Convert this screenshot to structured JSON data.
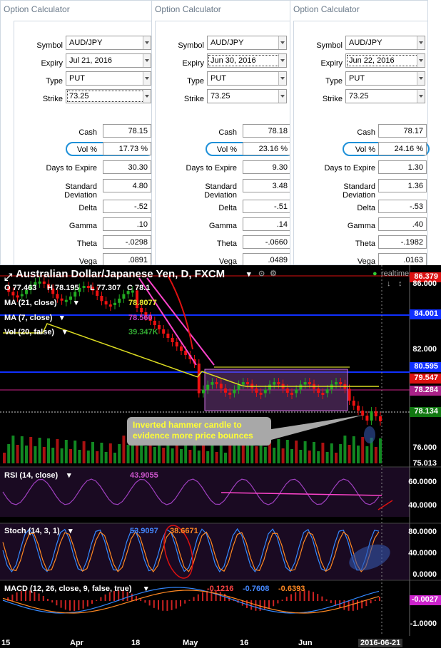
{
  "calculators": [
    {
      "title": "Option Calculator",
      "symbol": "AUD/JPY",
      "expiry": "Jul 21, 2016",
      "type": "PUT",
      "strike": "73.25",
      "cash": "78.15",
      "vol": "17.73 %",
      "days": "30.30",
      "stddev": "4.80",
      "delta": "-.52",
      "gamma": ".10",
      "theta": "-.0298",
      "vega": ".0891"
    },
    {
      "title": "Option Calculator",
      "symbol": "AUD/JPY",
      "expiry": "Jun 30, 2016",
      "type": "PUT",
      "strike": "73.25",
      "cash": "78.18",
      "vol": "23.16 %",
      "days": "9.30",
      "stddev": "3.48",
      "delta": "-.51",
      "gamma": ".14",
      "theta": "-.0660",
      "vega": ".0489"
    },
    {
      "title": "Option Calculator",
      "symbol": "AUD/JPY",
      "expiry": "Jun 22, 2016",
      "type": "PUT",
      "strike": "73.25",
      "cash": "78.17",
      "vol": "24.16 %",
      "days": "1.30",
      "stddev": "1.36",
      "delta": "-.53",
      "gamma": ".40",
      "theta": "-.1982",
      "vega": ".0163"
    }
  ],
  "labels": {
    "symbol": "Symbol",
    "expiry": "Expiry",
    "type": "Type",
    "strike": "Strike",
    "cash": "Cash",
    "vol": "Vol %",
    "days": "Days to Expire",
    "stddev": "Standard Deviation",
    "delta": "Delta",
    "gamma": "Gamma",
    "theta": "Theta",
    "vega": "Vega"
  },
  "chart": {
    "title": "Australian Dollar/Japanese Yen, D, FXCM",
    "realtime": "realtime",
    "ohlc": {
      "o": "O 77.463",
      "h": "H 78.195",
      "l": "L 77.307",
      "c": "C 78.1"
    },
    "ma21": "MA (21, close)",
    "ma21_val": "78.8077",
    "ma7": "MA (7, close)",
    "ma7_val": "78.560",
    "vol20": "Vol (20, false)",
    "vol_val": "39.347K",
    "rsi": "RSI (14, close)",
    "rsi_val": "43.9055",
    "stoch": "Stoch (14, 3, 1)",
    "stoch_k": "53.9097",
    "stoch_d": "38.6671",
    "macd": "MACD (12, 26, close, 9, false, true)",
    "macd_a": "-0.1216",
    "macd_b": "-0.7608",
    "macd_c": "-0.6393",
    "callout": "Inverted hammer candle to evidence more price bounces",
    "price_axis": [
      "86.000",
      "84.001",
      "82.000",
      "80.595",
      "79.547",
      "78.284",
      "78.134",
      "76.000",
      "75.013"
    ],
    "rsi_axis": [
      "60.0000",
      "40.0000"
    ],
    "stoch_axis": [
      "80.0000",
      "40.0000",
      "0.0000"
    ],
    "macd_axis": [
      "-0.0027",
      "-1.0000"
    ],
    "top_badge": "86.379",
    "dates": [
      "15",
      "Apr",
      "18",
      "May",
      "16",
      "Jun",
      "2016-06-21"
    ],
    "colors": {
      "bull": "#22aa22",
      "bear": "#ee1111",
      "ma": "#dddd22",
      "rsi": "#a040c0",
      "stoch_k": "#3388ff",
      "stoch_d": "#ff8822",
      "blue_line": "#1030ff",
      "pink": "#ff44cc"
    }
  }
}
